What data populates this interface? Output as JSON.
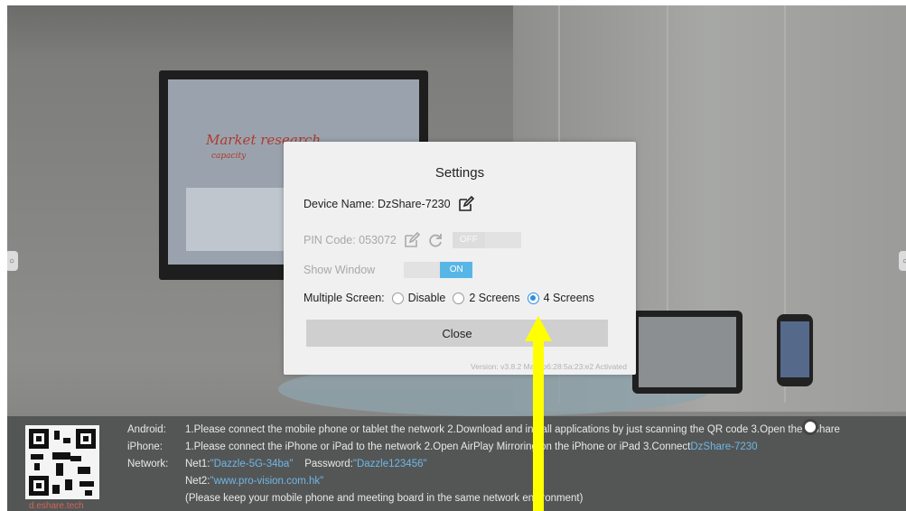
{
  "background": {
    "tv_handwriting": "Market research",
    "tv_subtext": "capacity"
  },
  "dialog": {
    "title": "Settings",
    "device_name_label": "Device Name:",
    "device_name_value": "DzShare-7230",
    "pin_label": "PIN Code:",
    "pin_value": "053072",
    "pin_toggle": "OFF",
    "show_window_label": "Show Window",
    "show_window_toggle": "ON",
    "multiple_screen_label": "Multiple Screen:",
    "options": [
      "Disable",
      "2 Screens",
      "4 Screens"
    ],
    "selected_option": "4 Screens",
    "close_label": "Close",
    "version_text": "Version: v3.8.2   Mac: b6:28:5a:23:e2 Activated"
  },
  "infobar": {
    "qr_label": "d.eshare.tech",
    "android_key": "Android:",
    "android_text": "1.Please connect the mobile phone or tablet the network    2.Download and install applications by just scanning the QR code    3.Open the EShare",
    "iphone_key": "iPhone:",
    "iphone_text_a": "1.Please connect the iPhone or iPad to the network    2.Open AirPlay Mirroring on the iPhone or iPad    3.Connect",
    "iphone_device": "DzShare-7230",
    "network_key": "Network:",
    "net1_label": "Net1:",
    "net1_ssid": "\"Dazzle-5G-34ba\"",
    "password_label": "Password:",
    "password_value": "\"Dazzle123456\"",
    "net2_label": "Net2:",
    "net2_value": "\"www.pro-vision.com.hk\"",
    "note": "(Please keep your mobile phone and meeting board in the same network environment)"
  },
  "colors": {
    "accent": "#58b6e6",
    "radio_selected": "#2d8ee0",
    "annotation_arrow": "#ffff00",
    "link": "#6fb7e6"
  },
  "icons": [
    "edit-icon",
    "refresh-icon",
    "left-handle-icon",
    "right-handle-icon",
    "cursor-icon",
    "annotation-arrow-icon"
  ]
}
